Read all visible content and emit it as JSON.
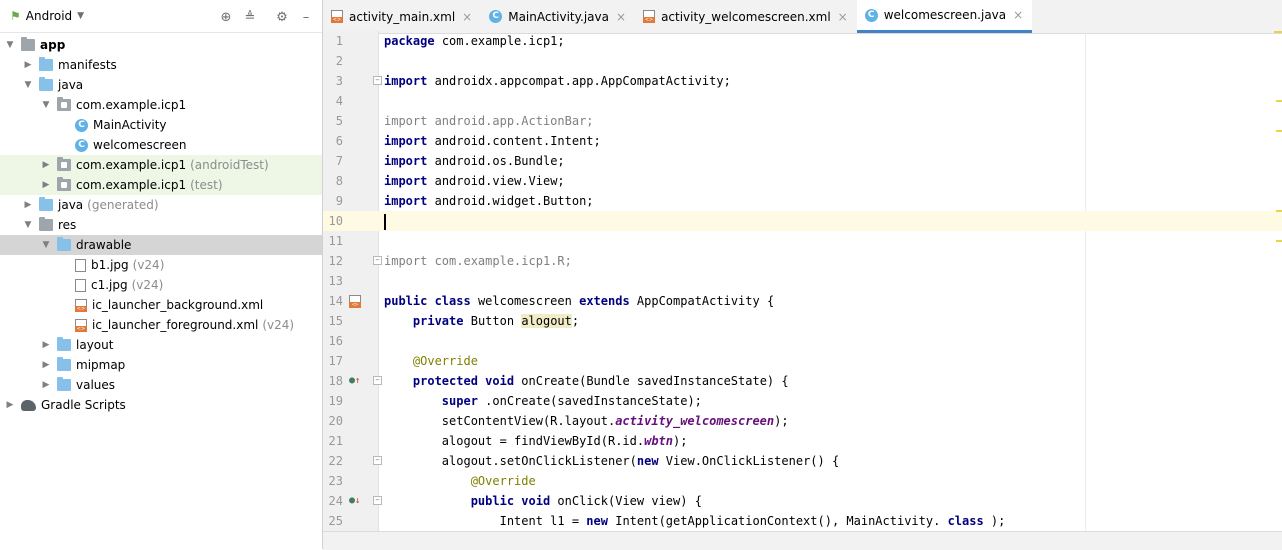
{
  "project_panel": {
    "view_label": "Android",
    "tools": [
      "target-icon",
      "collapse-icon",
      "gear-icon",
      "minimize-icon"
    ],
    "tree": [
      {
        "label": "app",
        "bold": true,
        "indent": 0,
        "arrow": "down",
        "icon": "module-folder-icon"
      },
      {
        "label": "manifests",
        "indent": 1,
        "arrow": "right",
        "icon": "folder-icon"
      },
      {
        "label": "java",
        "indent": 1,
        "arrow": "down",
        "icon": "folder-icon"
      },
      {
        "label": "com.example.icp1",
        "indent": 2,
        "arrow": "down",
        "icon": "package-icon"
      },
      {
        "label": "MainActivity",
        "indent": 3,
        "arrow": "none",
        "icon": "class-icon"
      },
      {
        "label": "welcomescreen",
        "indent": 3,
        "arrow": "none",
        "icon": "class-icon"
      },
      {
        "label": "com.example.icp1",
        "suffix": "(androidTest)",
        "indent": 2,
        "arrow": "right",
        "icon": "package-icon",
        "green": true
      },
      {
        "label": "com.example.icp1",
        "suffix": "(test)",
        "indent": 2,
        "arrow": "right",
        "icon": "package-icon",
        "green": true
      },
      {
        "label": "java",
        "suffix": "(generated)",
        "indent": 1,
        "arrow": "right",
        "icon": "folder-icon"
      },
      {
        "label": "res",
        "indent": 1,
        "arrow": "down",
        "icon": "res-folder-icon"
      },
      {
        "label": "drawable",
        "indent": 2,
        "arrow": "down",
        "icon": "folder-icon",
        "selected": true
      },
      {
        "label": "b1.jpg",
        "suffix": "(v24)",
        "indent": 3,
        "arrow": "none",
        "icon": "image-file-icon"
      },
      {
        "label": "c1.jpg",
        "suffix": "(v24)",
        "indent": 3,
        "arrow": "none",
        "icon": "image-file-icon"
      },
      {
        "label": "ic_launcher_background.xml",
        "indent": 3,
        "arrow": "none",
        "icon": "xml-file-icon"
      },
      {
        "label": "ic_launcher_foreground.xml",
        "suffix": "(v24)",
        "indent": 3,
        "arrow": "none",
        "icon": "xml-file-icon"
      },
      {
        "label": "layout",
        "indent": 2,
        "arrow": "right",
        "icon": "folder-icon"
      },
      {
        "label": "mipmap",
        "indent": 2,
        "arrow": "right",
        "icon": "folder-icon"
      },
      {
        "label": "values",
        "indent": 2,
        "arrow": "right",
        "icon": "folder-icon"
      },
      {
        "label": "Gradle Scripts",
        "indent": 0,
        "arrow": "right",
        "icon": "gradle-icon"
      }
    ]
  },
  "editor": {
    "tabs": [
      {
        "label": "activity_main.xml",
        "icon": "xml-file-icon",
        "active": false
      },
      {
        "label": "MainActivity.java",
        "icon": "class-icon",
        "active": false
      },
      {
        "label": "activity_welcomescreen.xml",
        "icon": "xml-file-icon",
        "active": false
      },
      {
        "label": "welcomescreen.java",
        "icon": "class-icon",
        "active": true
      }
    ],
    "lines": [
      {
        "n": "1",
        "tokens": [
          [
            "k",
            "package"
          ],
          [
            "",
            "com.example.icp1;"
          ]
        ]
      },
      {
        "n": "2",
        "tokens": []
      },
      {
        "n": "3",
        "fold": true,
        "tokens": [
          [
            "k",
            "import"
          ],
          [
            "",
            "androidx.appcompat.app.AppCompatActivity;"
          ]
        ]
      },
      {
        "n": "4",
        "tokens": []
      },
      {
        "n": "5",
        "tokens": [
          [
            "gray",
            "import android.app.ActionBar;"
          ]
        ]
      },
      {
        "n": "6",
        "tokens": [
          [
            "k",
            "import"
          ],
          [
            "",
            "android.content.Intent;"
          ]
        ]
      },
      {
        "n": "7",
        "tokens": [
          [
            "k",
            "import"
          ],
          [
            "",
            "android.os.Bundle;"
          ]
        ]
      },
      {
        "n": "8",
        "tokens": [
          [
            "k",
            "import"
          ],
          [
            "",
            "android.view.View;"
          ]
        ]
      },
      {
        "n": "9",
        "tokens": [
          [
            "k",
            "import"
          ],
          [
            "",
            "android.widget.Button;"
          ]
        ]
      },
      {
        "n": "10",
        "current": true,
        "tokens": []
      },
      {
        "n": "11",
        "tokens": []
      },
      {
        "n": "12",
        "fold": true,
        "tokens": [
          [
            "gray",
            "import com.example.icp1.R;"
          ]
        ]
      },
      {
        "n": "13",
        "tokens": []
      },
      {
        "n": "14",
        "marker": "xml",
        "tokens": [
          [
            "k",
            "public class"
          ],
          [
            "",
            "welcomescreen"
          ],
          [
            "k",
            "extends"
          ],
          [
            "",
            "AppCompatActivity {"
          ]
        ]
      },
      {
        "n": "15",
        "tokens": [
          [
            "",
            "    "
          ],
          [
            "k",
            "private"
          ],
          [
            "",
            "Button"
          ],
          [
            "hl",
            "alogout"
          ],
          [
            "",
            ";"
          ]
        ]
      },
      {
        "n": "16",
        "tokens": []
      },
      {
        "n": "17",
        "tokens": [
          [
            "",
            "    "
          ],
          [
            "ann",
            "@Override"
          ]
        ]
      },
      {
        "n": "18",
        "marker": "override",
        "fold": true,
        "tokens": [
          [
            "",
            "    "
          ],
          [
            "k",
            "protected void"
          ],
          [
            "",
            "onCreate(Bundle savedInstanceState) {"
          ]
        ]
      },
      {
        "n": "19",
        "tokens": [
          [
            "",
            "        "
          ],
          [
            "k",
            "super"
          ],
          [
            "",
            ".onCreate(savedInstanceState);"
          ]
        ]
      },
      {
        "n": "20",
        "tokens": [
          [
            "",
            "        setContentView(R.layout."
          ],
          [
            "it",
            "activity_welcomescreen"
          ],
          [
            "",
            ");"
          ]
        ]
      },
      {
        "n": "21",
        "tokens": [
          [
            "",
            "        alogout = findViewById(R.id."
          ],
          [
            "it",
            "wbtn"
          ],
          [
            "",
            ");"
          ]
        ]
      },
      {
        "n": "22",
        "fold": true,
        "tokens": [
          [
            "",
            "        alogout.setOnClickListener("
          ],
          [
            "k",
            "new"
          ],
          [
            "",
            "View.OnClickListener() {"
          ]
        ]
      },
      {
        "n": "23",
        "tokens": [
          [
            "",
            "            "
          ],
          [
            "ann",
            "@Override"
          ]
        ]
      },
      {
        "n": "24",
        "marker": "implement",
        "fold": true,
        "tokens": [
          [
            "",
            "            "
          ],
          [
            "k",
            "public void"
          ],
          [
            "",
            "onClick(View view) {"
          ]
        ]
      },
      {
        "n": "25",
        "tokens": [
          [
            "",
            "                Intent l1 = "
          ],
          [
            "k",
            "new"
          ],
          [
            "",
            "Intent(getApplicationContext(), MainActivity."
          ],
          [
            "k",
            "class"
          ],
          [
            "",
            ");"
          ]
        ]
      }
    ]
  },
  "colors": {
    "keyword": "#000080",
    "annotation": "#808000",
    "field": "#660e7a",
    "tab_underline": "#4083c9",
    "current_line": "#fefae3"
  }
}
